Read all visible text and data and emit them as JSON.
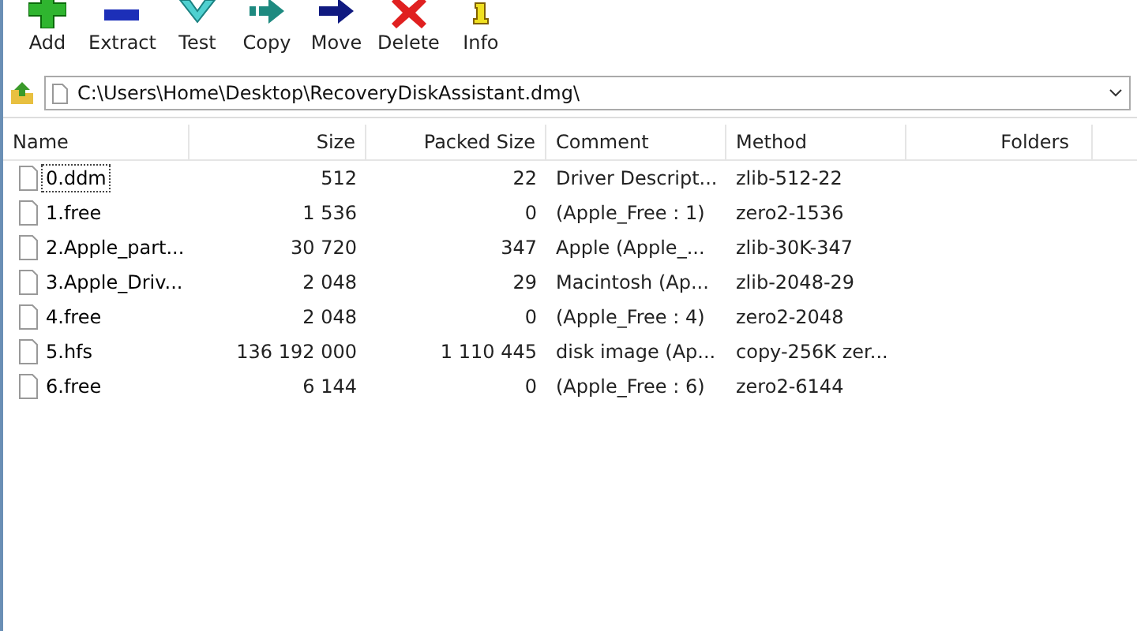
{
  "toolbar": [
    {
      "kind": "add",
      "label": "Add"
    },
    {
      "kind": "extract",
      "label": "Extract"
    },
    {
      "kind": "test",
      "label": "Test"
    },
    {
      "kind": "copy",
      "label": "Copy"
    },
    {
      "kind": "move",
      "label": "Move"
    },
    {
      "kind": "delete",
      "label": "Delete"
    },
    {
      "kind": "info",
      "label": "Info"
    }
  ],
  "address": {
    "path": "C:\\Users\\Home\\Desktop\\RecoveryDiskAssistant.dmg\\"
  },
  "table": {
    "columns": [
      "Name",
      "Size",
      "Packed Size",
      "Comment",
      "Method",
      "Folders"
    ],
    "rows": [
      {
        "name": "0.ddm",
        "size": "512",
        "packed": "22",
        "comment": "Driver Descript...",
        "method": "zlib-512-22",
        "focused": true
      },
      {
        "name": "1.free",
        "size": "1 536",
        "packed": "0",
        "comment": "(Apple_Free : 1)",
        "method": "zero2-1536",
        "focused": false
      },
      {
        "name": "2.Apple_part...",
        "size": "30 720",
        "packed": "347",
        "comment": "Apple (Apple_...",
        "method": "zlib-30K-347",
        "focused": false
      },
      {
        "name": "3.Apple_Driv...",
        "size": "2 048",
        "packed": "29",
        "comment": "Macintosh (Ap...",
        "method": "zlib-2048-29",
        "focused": false
      },
      {
        "name": "4.free",
        "size": "2 048",
        "packed": "0",
        "comment": "(Apple_Free : 4)",
        "method": "zero2-2048",
        "focused": false
      },
      {
        "name": "5.hfs",
        "size": "136 192 000",
        "packed": "1 110 445",
        "comment": "disk image (Ap...",
        "method": "copy-256K zer...",
        "focused": false
      },
      {
        "name": "6.free",
        "size": "6 144",
        "packed": "0",
        "comment": "(Apple_Free : 6)",
        "method": "zero2-6144",
        "focused": false
      }
    ]
  }
}
